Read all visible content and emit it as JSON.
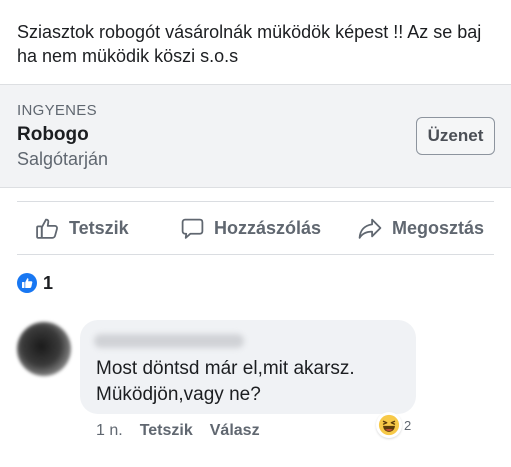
{
  "post": {
    "text": "Sziasztok robogót vásárolnák müködök képest !! Az se baj ha nem müködik  köszi s.o.s"
  },
  "listing": {
    "tag": "INGYENES",
    "title": "Robogo",
    "location": "Salgótarján",
    "message_button": "Üzenet"
  },
  "actions": {
    "like": "Tetszik",
    "comment": "Hozzászólás",
    "share": "Megosztás"
  },
  "reactions": {
    "like_icon": "thumbs-up-icon",
    "count": "1",
    "accent": "#1877f2"
  },
  "comment": {
    "text": "Most döntsd már el,mit akarsz. Müködjön,vagy ne?",
    "time": "1 n.",
    "like_link": "Tetszik",
    "reply_link": "Válasz",
    "reaction_icon": "laughing-emoji-icon",
    "reaction_count": "2"
  }
}
